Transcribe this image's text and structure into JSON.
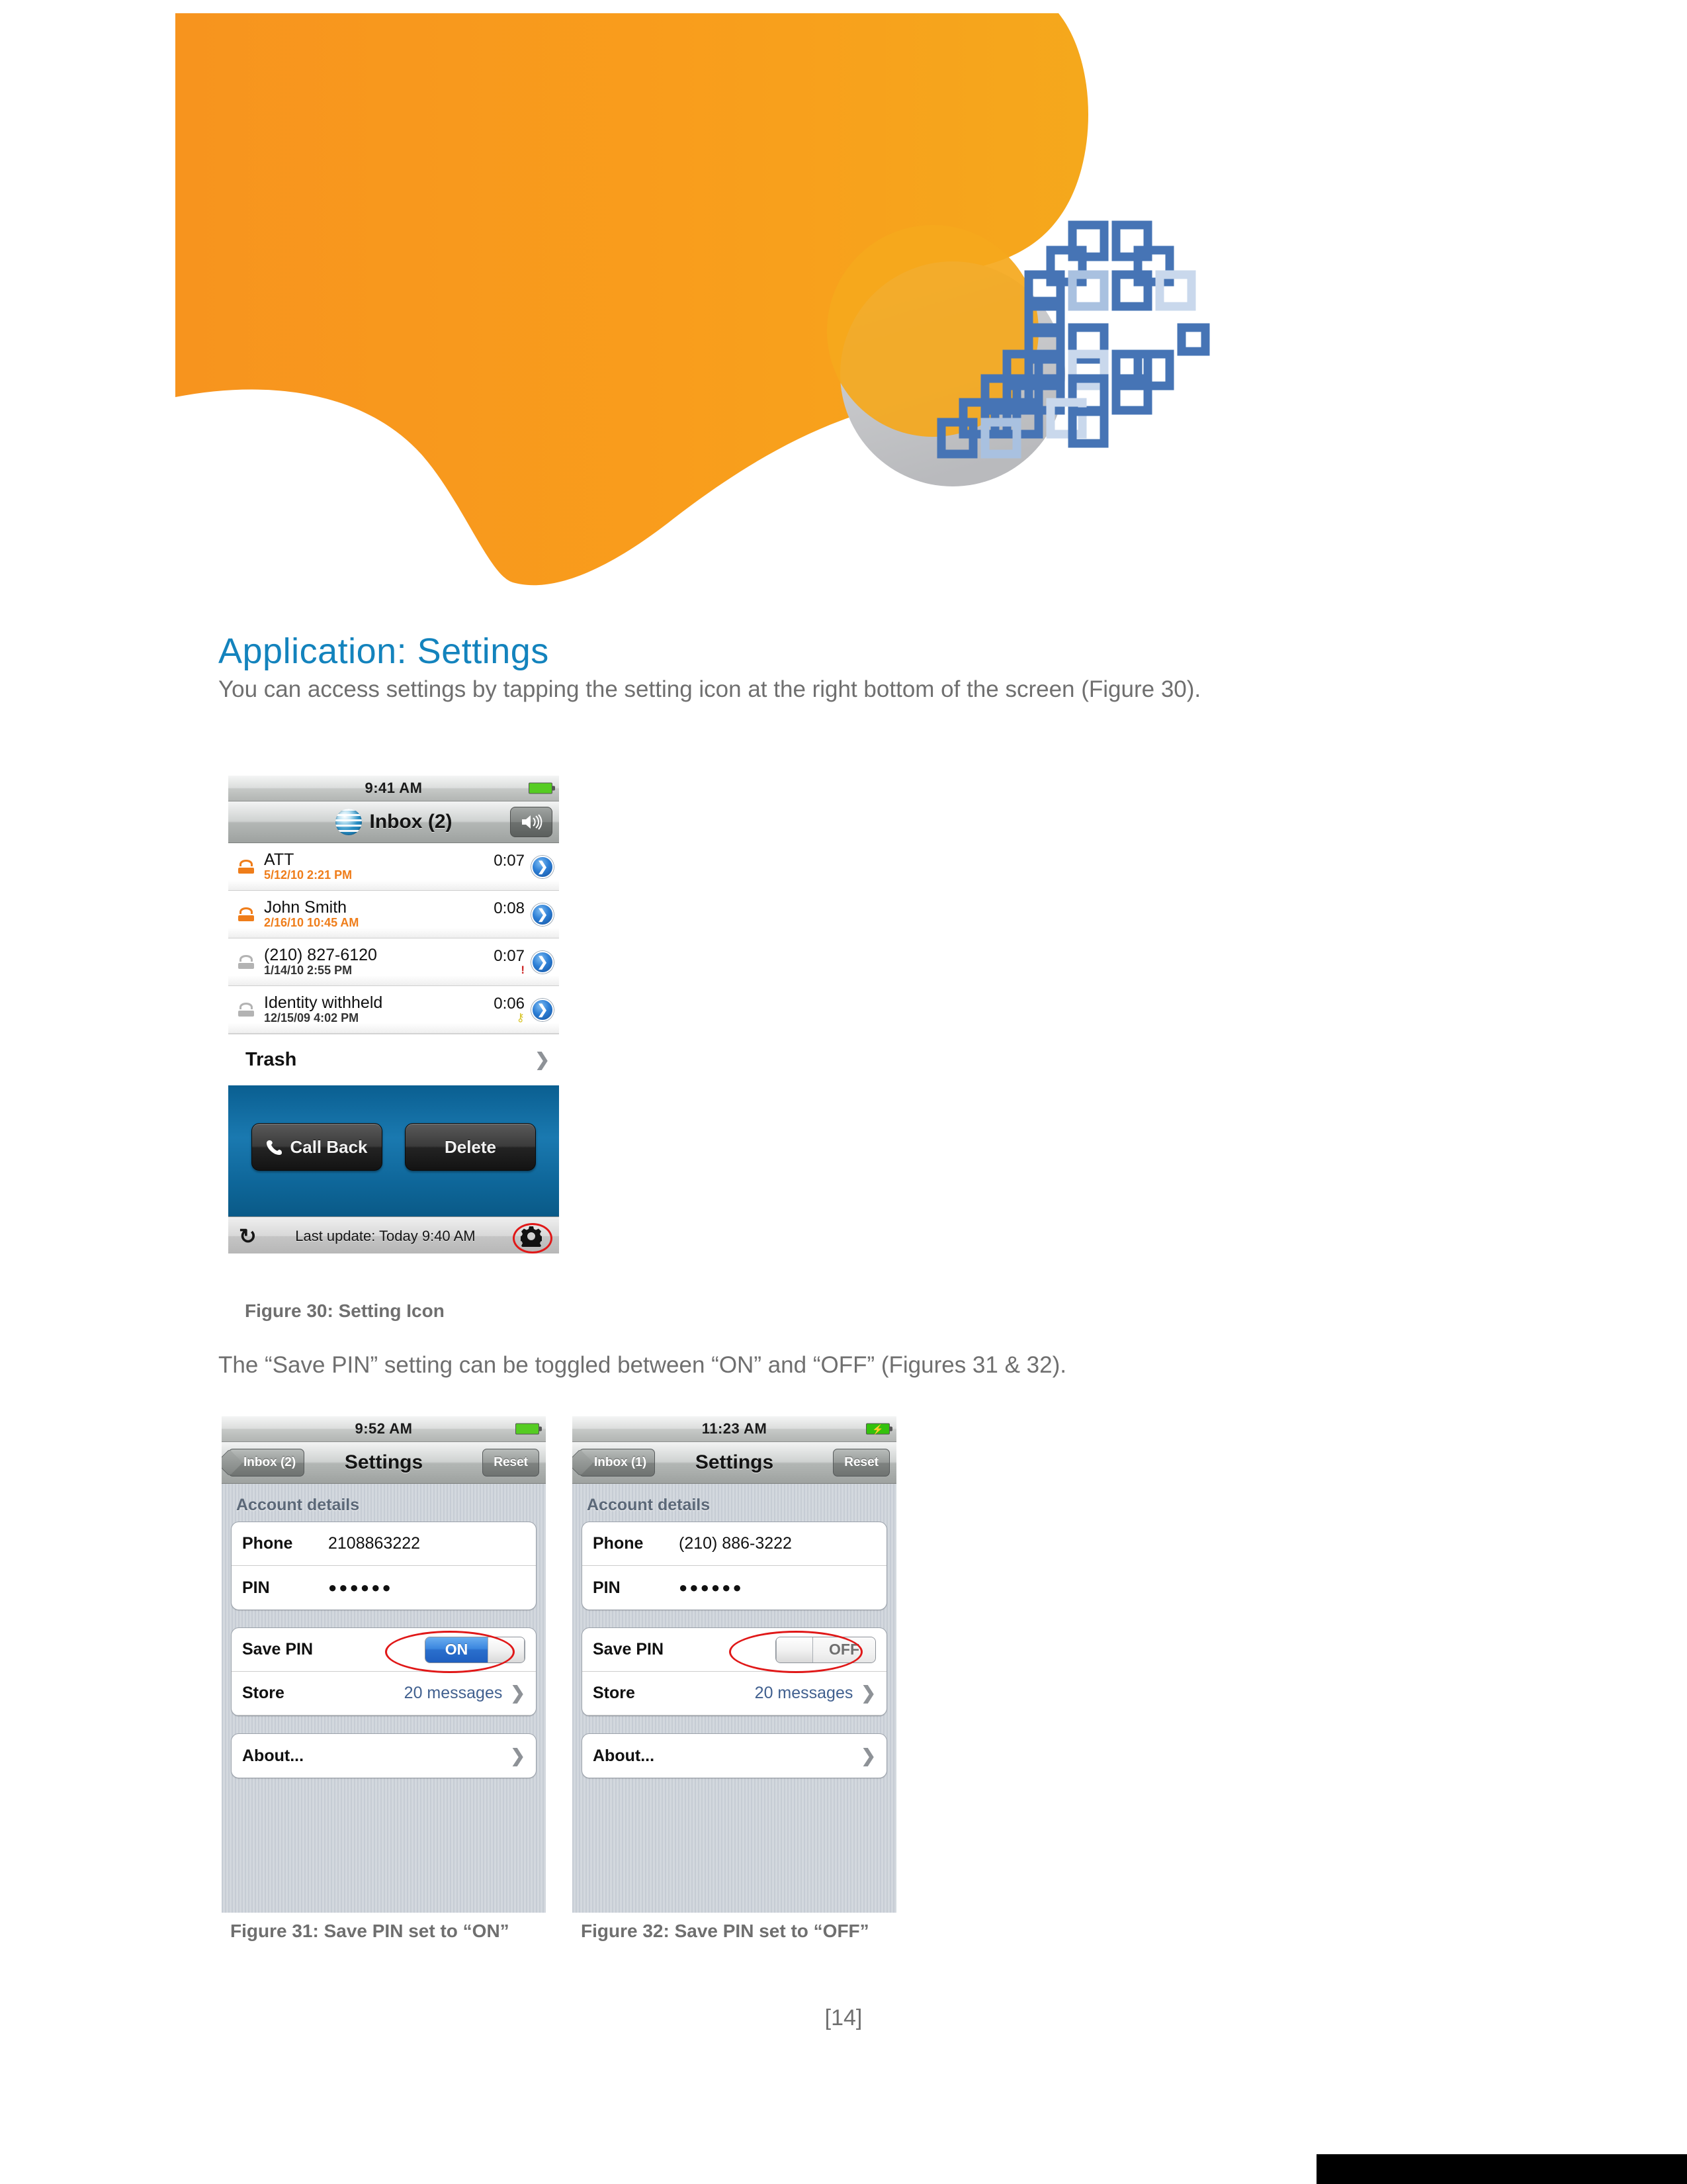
{
  "page": {
    "title": "Application: Settings",
    "title_color": "#1383bd",
    "page_number": "[14]",
    "paragraph_1": "You can access settings by tapping the setting icon at the right bottom of the screen (Figure 30).",
    "paragraph_2": "The “Save PIN” setting can be toggled between “ON” and “OFF” (Figures 31 & 32)."
  },
  "header_graphic": {
    "orange_color": "#f7941e",
    "orange_color_light": "#f6a723",
    "gray_circle_color": "#bcbdc0",
    "pixel_color": "#4674b5"
  },
  "figure30": {
    "caption": "Figure 30: Setting Icon",
    "status": {
      "time": "9:41 AM",
      "battery_icon": "battery-icon"
    },
    "nav": {
      "title": "Inbox (2)",
      "logo_icon": "att-globe-icon",
      "speaker_icon": "speaker-icon"
    },
    "messages": [
      {
        "icon": "phone-unread-icon",
        "name": "ATT",
        "date": "5/12/10 2:21 PM",
        "unread": true,
        "duration": "0:07",
        "flag": "",
        "flag_type": "none"
      },
      {
        "icon": "phone-unread-icon",
        "name": "John Smith",
        "date": "2/16/10 10:45 AM",
        "unread": true,
        "duration": "0:08",
        "flag": "",
        "flag_type": "none"
      },
      {
        "icon": "phone-read-icon",
        "name": "(210) 827-6120",
        "date": "1/14/10 2:55 PM",
        "unread": false,
        "duration": "0:07",
        "flag": "!",
        "flag_type": "urgent"
      },
      {
        "icon": "phone-read-icon",
        "name": "Identity withheld",
        "date": "12/15/09 4:02 PM",
        "unread": false,
        "duration": "0:06",
        "flag": "⚷",
        "flag_type": "private"
      }
    ],
    "trash_label": "Trash",
    "actions": {
      "call_back": "Call Back",
      "delete": "Delete"
    },
    "bottom": {
      "refresh_icon": "refresh-icon",
      "last_update": "Last update: Today 9:40 AM",
      "settings_icon": "gear-icon",
      "highlight_color": "#e01818"
    }
  },
  "figure31": {
    "caption": "Figure 31: Save PIN set to “ON”",
    "status": {
      "time": "9:52 AM",
      "battery_icon": "battery-icon",
      "charging": false
    },
    "nav": {
      "back_label": "Inbox (2)",
      "title": "Settings",
      "reset_label": "Reset"
    },
    "section_header": "Account details",
    "rows": {
      "phone_label": "Phone",
      "phone_value": "2108863222",
      "pin_label": "PIN",
      "pin_value": "●●●●●●",
      "save_pin_label": "Save PIN",
      "save_pin_state": "ON",
      "store_label": "Store",
      "store_value": "20 messages",
      "about_label": "About..."
    }
  },
  "figure32": {
    "caption": "Figure 32: Save PIN set to “OFF”",
    "status": {
      "time": "11:23 AM",
      "battery_icon": "battery-charging-icon",
      "charging": true
    },
    "nav": {
      "back_label": "Inbox (1)",
      "title": "Settings",
      "reset_label": "Reset"
    },
    "section_header": "Account details",
    "rows": {
      "phone_label": "Phone",
      "phone_value": "(210) 886-3222",
      "pin_label": "PIN",
      "pin_value": "●●●●●●",
      "save_pin_label": "Save PIN",
      "save_pin_state": "OFF",
      "store_label": "Store",
      "store_value": "20 messages",
      "about_label": "About..."
    }
  }
}
